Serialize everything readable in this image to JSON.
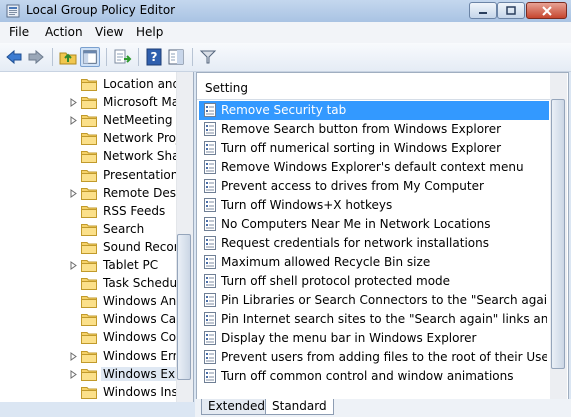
{
  "window": {
    "title": "Local Group Policy Editor"
  },
  "menu": [
    "File",
    "Action",
    "View",
    "Help"
  ],
  "toolbar": {
    "buttons": [
      "back-icon",
      "forward-icon",
      "up-folder-icon",
      "show-hide-tree-icon",
      "export-list-icon",
      "help-icon",
      "properties-pane-icon",
      "filter-icon"
    ]
  },
  "tree": {
    "items": [
      {
        "label": "Location and",
        "expand": false
      },
      {
        "label": "Microsoft Ma",
        "expand": true
      },
      {
        "label": "NetMeeting",
        "expand": true
      },
      {
        "label": "Network Proje",
        "expand": false
      },
      {
        "label": "Network Shar",
        "expand": false
      },
      {
        "label": "Presentation S",
        "expand": false
      },
      {
        "label": "Remote Deskt",
        "expand": true
      },
      {
        "label": "RSS Feeds",
        "expand": false
      },
      {
        "label": "Search",
        "expand": false
      },
      {
        "label": "Sound Record",
        "expand": false
      },
      {
        "label": "Tablet PC",
        "expand": true
      },
      {
        "label": "Task Schedule",
        "expand": false
      },
      {
        "label": "Windows Any",
        "expand": false
      },
      {
        "label": "Windows Cale",
        "expand": false
      },
      {
        "label": "Windows Col",
        "expand": false
      },
      {
        "label": "Windows Erro",
        "expand": true
      },
      {
        "label": "Windows Exp",
        "expand": true,
        "selected": true
      },
      {
        "label": "Windows Inst",
        "expand": false
      }
    ]
  },
  "settings": {
    "header": "Setting",
    "items": [
      "Remove Security tab",
      "Remove Search button from Windows Explorer",
      "Turn off numerical sorting in Windows Explorer",
      "Remove Windows Explorer's default context menu",
      "Prevent access to drives from My Computer",
      "Turn off Windows+X hotkeys",
      "No Computers Near Me in Network Locations",
      "Request credentials for network installations",
      "Maximum allowed Recycle Bin size",
      "Turn off shell protocol protected mode",
      "Pin Libraries or Search Connectors to the \"Search again\" link...",
      "Pin Internet search sites to the \"Search again\" links and the S...",
      "Display the menu bar in Windows Explorer",
      "Prevent users from adding files to the root of their Users File...",
      "Turn off common control and window animations"
    ],
    "selected_index": 0
  },
  "tabs": [
    {
      "label": "Extended",
      "active": false
    },
    {
      "label": "Standard",
      "active": true
    }
  ],
  "colors": {
    "selection": "#3399ff",
    "tree_selection": "#dfe8f3",
    "title_bar": "#b7cde8"
  }
}
